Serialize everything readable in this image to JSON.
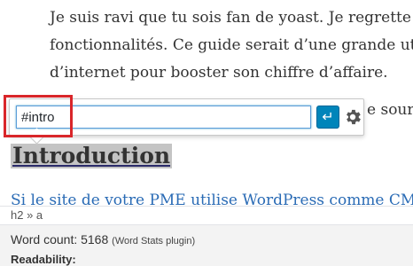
{
  "editor": {
    "paragraph_lines": [
      "Je suis ravi que tu sois fan de yoast. Je regrette qu’il n",
      "fonctionnalités. Ce guide serait d’une grande utilité à t",
      "d’internet pour booster son chiffre d’affaire."
    ],
    "line4_fragment": "e sourc",
    "heading": "Introduction",
    "link_paragraph": "Si le site de votre PME utilise WordPress comme CMS, c’est"
  },
  "link_popover": {
    "url_value": "#intro",
    "apply_icon": "enter-arrow-icon",
    "settings_icon": "gear-icon"
  },
  "statusbar": {
    "path": "h2 » a"
  },
  "info": {
    "word_count_label": "Word count: 5168",
    "word_count_note": "(Word Stats plugin)",
    "readability_label": "Readability:"
  },
  "colors": {
    "accent": "#0085ba",
    "highlight_box": "#d9262a",
    "heading_bg": "#c4c4c4"
  }
}
